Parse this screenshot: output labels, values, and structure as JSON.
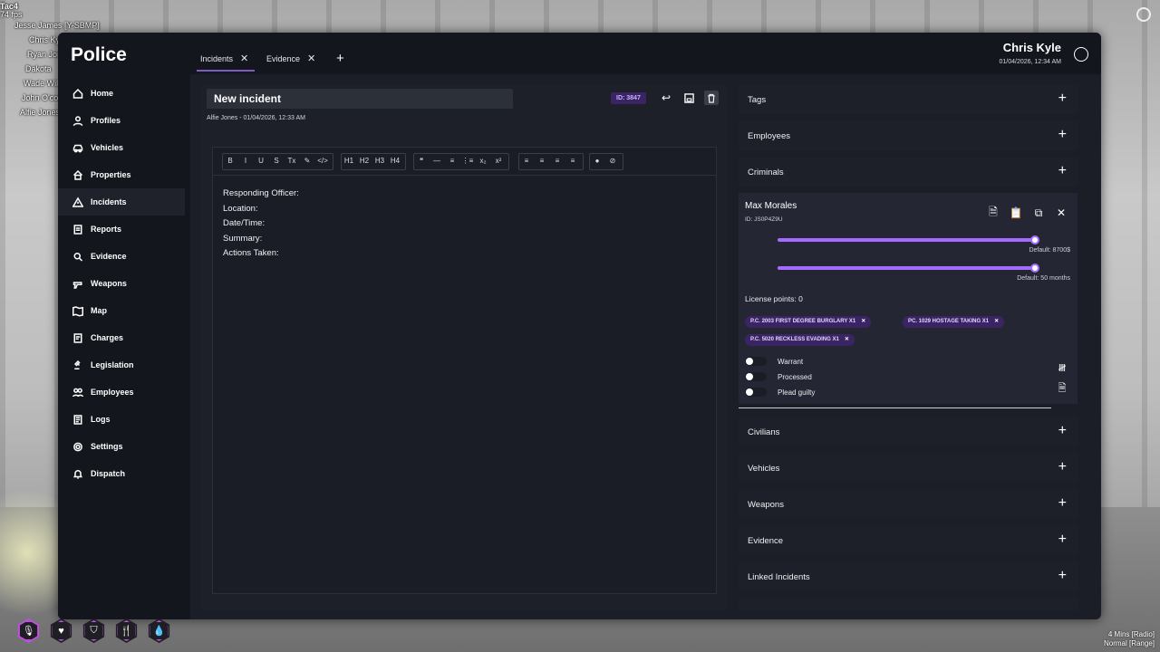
{
  "overlay": {
    "header": "Tac4",
    "fps": "74 fps",
    "players": [
      "Jesse James [Y-SBMP]",
      "Chris Kyle",
      "Ryan Jones",
      "Dakota",
      "Wade Wilson",
      "John O'connor",
      "Alfie Jones"
    ]
  },
  "bottom_right": {
    "line1": "4 Mins [Radio]",
    "line2": "Normal [Range]"
  },
  "app": {
    "title": "Police"
  },
  "user": {
    "name": "Chris Kyle",
    "datetime": "01/04/2026, 12:34 AM"
  },
  "tabs": [
    {
      "label": "Incidents",
      "active": true
    },
    {
      "label": "Evidence",
      "active": false
    }
  ],
  "sidebar": {
    "items": [
      {
        "label": "Home",
        "icon": "home-icon"
      },
      {
        "label": "Profiles",
        "icon": "user-icon"
      },
      {
        "label": "Vehicles",
        "icon": "car-icon"
      },
      {
        "label": "Properties",
        "icon": "house-icon"
      },
      {
        "label": "Incidents",
        "icon": "warning-icon",
        "active": true
      },
      {
        "label": "Reports",
        "icon": "report-icon"
      },
      {
        "label": "Evidence",
        "icon": "search-icon"
      },
      {
        "label": "Weapons",
        "icon": "gun-icon"
      },
      {
        "label": "Map",
        "icon": "map-icon"
      },
      {
        "label": "Charges",
        "icon": "document-icon"
      },
      {
        "label": "Legislation",
        "icon": "gavel-icon"
      },
      {
        "label": "Employees",
        "icon": "users-icon"
      },
      {
        "label": "Logs",
        "icon": "log-icon"
      },
      {
        "label": "Settings",
        "icon": "gear-icon"
      },
      {
        "label": "Dispatch",
        "icon": "bell-icon"
      }
    ]
  },
  "incident": {
    "title": "New incident",
    "meta": "Alfie Jones - 01/04/2026, 12:33 AM",
    "id_badge": "ID: 3847",
    "body_lines": [
      "Responding Officer:",
      "Location:",
      "Date/Time:",
      "Summary:",
      "Actions Taken:"
    ]
  },
  "toolbar": {
    "groups": [
      [
        "B",
        "I",
        "U",
        "S",
        "Tx",
        "✎",
        "</>"
      ],
      [
        "H1",
        "H2",
        "H3",
        "H4"
      ],
      [
        "❝",
        "—",
        "≡",
        "⋮≡",
        "x₂",
        "x²"
      ],
      [
        "≡",
        "≡",
        "≡",
        "≡"
      ],
      [
        "●",
        "⊘"
      ]
    ]
  },
  "right_sections_top": [
    "Tags",
    "Employees",
    "Criminals"
  ],
  "criminal": {
    "name": "Max Morales",
    "id": "ID: JS0P4Z9U",
    "fine_default": "Default: 8700$",
    "fine_fraction": 1.0,
    "jail_default": "Default: 50 months",
    "jail_fraction": 1.0,
    "license_points": "License points: 0",
    "charges": [
      "P.C. 2003 FIRST DEGREE BURGLARY X1",
      "PC. 1029 HOSTAGE TAKING X1",
      "P.C. 5020 RECKLESS EVADING X1"
    ],
    "toggles": [
      "Warrant",
      "Processed",
      "Plead guilty"
    ]
  },
  "right_sections_bottom": [
    "Civilians",
    "Vehicles",
    "Weapons",
    "Evidence",
    "Linked Incidents"
  ],
  "accent": "#a36bff"
}
